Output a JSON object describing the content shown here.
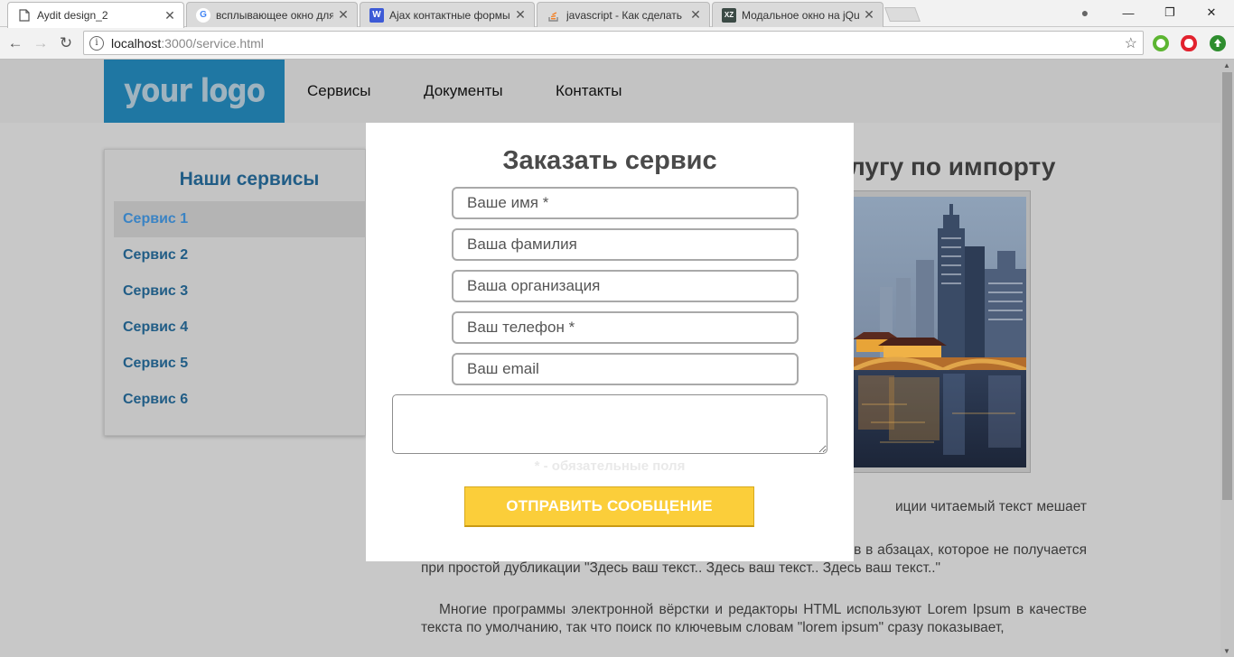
{
  "browser": {
    "tabs": [
      {
        "title": "Aydit design_2",
        "icon": "page-icon",
        "active": true
      },
      {
        "title": "всплывающее окно для",
        "icon": "google-icon",
        "active": false
      },
      {
        "title": "Ajax контактные формы",
        "icon": "w-icon",
        "active": false
      },
      {
        "title": "javascript - Как сделать",
        "icon": "stackoverflow-icon",
        "active": false
      },
      {
        "title": "Модальное окно на jQu",
        "icon": "xz-icon",
        "active": false
      }
    ],
    "favicon_letters": {
      "w": "W",
      "xz": "XZ",
      "google": "G"
    },
    "url_host": "localhost",
    "url_path": ":3000/service.html",
    "info_glyph": "i",
    "star_glyph": "☆",
    "nav_glyphs": {
      "back": "←",
      "forward": "→",
      "reload": "↻",
      "close": "✕",
      "min": "—",
      "restore": "❐",
      "profile": "●"
    }
  },
  "site": {
    "logo_text": "your logo",
    "nav": [
      "Сервисы",
      "Документы",
      "Контакты"
    ],
    "sidebar": {
      "title": "Наши сервисы",
      "items": [
        "Сервис 1",
        "Сервис 2",
        "Сервис 3",
        "Сервис 4",
        "Сервис 5",
        "Сервис 6"
      ],
      "active_index": 0
    },
    "content_title_visible": "лугу по импорту",
    "paragraphs": [
      "иции читаемый текст мешает",
      "вение шаблона, а также реальное распределение букв и пробелов в абзацах, которое не получается при простой дубликации \"Здесь ваш текст.. Здесь ваш текст.. Здесь ваш текст..\"",
      "Многие программы электронной вёрстки и редакторы HTML используют Lorem Ipsum в качестве текста по умолчанию, так что поиск по ключевым словам \"lorem ipsum\" сразу показывает,"
    ]
  },
  "modal": {
    "title": "Заказать сервис",
    "fields": [
      {
        "placeholder": "Ваше имя *",
        "value": ""
      },
      {
        "placeholder": "Ваша фамилия",
        "value": ""
      },
      {
        "placeholder": "Ваша организация",
        "value": ""
      },
      {
        "placeholder": "Ваш телефон *",
        "value": ""
      },
      {
        "placeholder": "Ваш email",
        "value": ""
      }
    ],
    "message_value": "",
    "required_note": "* - обязательные поля",
    "submit_label": "ОТПРАВИТЬ СООБЩЕНИЕ"
  },
  "colors": {
    "logo_bg": "#1f77a3",
    "sidebar_link": "#215d86",
    "sidebar_active": "#3a83c4",
    "submit_bg": "#fbce3a",
    "page_overlay": "#c8c8c8"
  }
}
